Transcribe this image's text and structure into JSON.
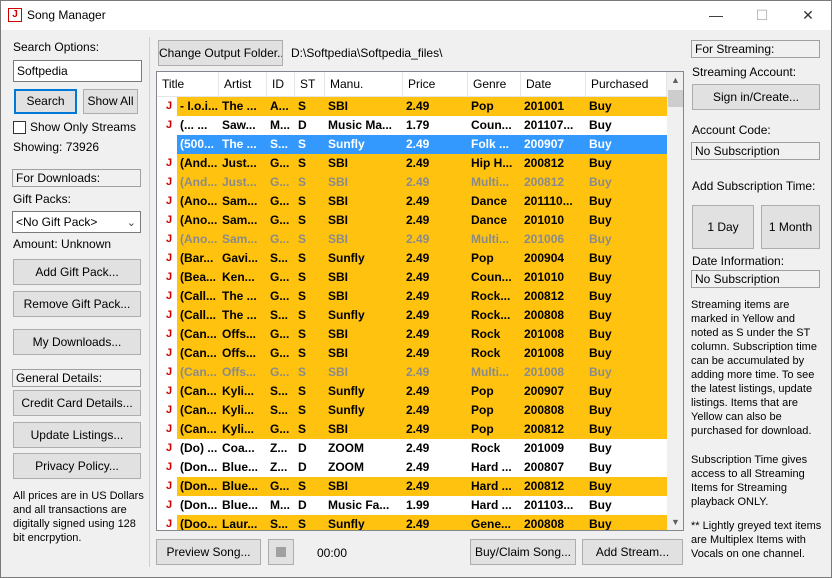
{
  "window": {
    "title": "Song Manager",
    "minimize_glyph": "—",
    "maximize_glyph": "☐",
    "close_glyph": "✕"
  },
  "left": {
    "search_options_label": "Search Options:",
    "search_value": "Softpedia",
    "search_button": "Search",
    "show_all_button": "Show All",
    "show_only_streams_label": "Show Only Streams",
    "showing_text": "Showing: 73926",
    "for_downloads_label": "For Downloads:",
    "gift_packs_label": "Gift Packs:",
    "gift_pack_selected": "<No Gift Pack>",
    "amount_text": "Amount: Unknown",
    "add_gift_pack_button": "Add Gift Pack...",
    "remove_gift_pack_button": "Remove Gift Pack...",
    "my_downloads_button": "My Downloads...",
    "general_details_label": "General Details:",
    "credit_card_button": "Credit Card Details...",
    "update_listings_button": "Update Listings...",
    "privacy_policy_button": "Privacy Policy...",
    "pricing_note": "All prices are in US Dollars and all transactions are digitally signed using 128 bit encrpytion."
  },
  "top": {
    "change_output_button": "Change Output Folder...",
    "output_path": "D:\\Softpedia\\Softpedia_files\\"
  },
  "table": {
    "columns": [
      "Title",
      "Artist",
      "ID",
      "ST",
      "Manu.",
      "Price",
      "Genre",
      "Date",
      "Purchased"
    ],
    "icon_glyph": "J",
    "rows": [
      {
        "style": "yellow",
        "cells": [
          "- I.o.i...",
          "The ...",
          "A...",
          "S",
          "SBI",
          "2.49",
          "Pop",
          "201001",
          "Buy"
        ]
      },
      {
        "style": "white",
        "cells": [
          "(... ...",
          "Saw...",
          "M...",
          "D",
          "Music Ma...",
          "1.79",
          "Coun...",
          "201107...",
          "Buy"
        ]
      },
      {
        "style": "sel",
        "cells": [
          "(500...",
          "The ...",
          "S...",
          "S",
          "Sunfly",
          "2.49",
          "Folk ...",
          "200907",
          "Buy"
        ]
      },
      {
        "style": "yellow",
        "cells": [
          "(And...",
          "Just...",
          "G...",
          "S",
          "SBI",
          "2.49",
          "Hip H...",
          "200812",
          "Buy"
        ]
      },
      {
        "style": "yellow grey",
        "cells": [
          "(And...",
          "Just...",
          "G...",
          "S",
          "SBI",
          "2.49",
          "Multi...",
          "200812",
          "Buy"
        ]
      },
      {
        "style": "yellow",
        "cells": [
          "(Ano...",
          "Sam...",
          "G...",
          "S",
          "SBI",
          "2.49",
          "Dance",
          "201110...",
          "Buy"
        ]
      },
      {
        "style": "yellow",
        "cells": [
          "(Ano...",
          "Sam...",
          "G...",
          "S",
          "SBI",
          "2.49",
          "Dance",
          "201010",
          "Buy"
        ]
      },
      {
        "style": "yellow grey",
        "cells": [
          "(Ano...",
          "Sam...",
          "G...",
          "S",
          "SBI",
          "2.49",
          "Multi...",
          "201006",
          "Buy"
        ]
      },
      {
        "style": "yellow",
        "cells": [
          "(Bar...",
          "Gavi...",
          "S...",
          "S",
          "Sunfly",
          "2.49",
          "Pop",
          "200904",
          "Buy"
        ]
      },
      {
        "style": "yellow",
        "cells": [
          "(Bea...",
          "Ken...",
          "G...",
          "S",
          "SBI",
          "2.49",
          "Coun...",
          "201010",
          "Buy"
        ]
      },
      {
        "style": "yellow",
        "cells": [
          "(Call...",
          "The ...",
          "G...",
          "S",
          "SBI",
          "2.49",
          "Rock...",
          "200812",
          "Buy"
        ]
      },
      {
        "style": "yellow",
        "cells": [
          "(Call...",
          "The ...",
          "S...",
          "S",
          "Sunfly",
          "2.49",
          "Rock...",
          "200808",
          "Buy"
        ]
      },
      {
        "style": "yellow",
        "cells": [
          "(Can...",
          "Offs...",
          "G...",
          "S",
          "SBI",
          "2.49",
          "Rock",
          "201008",
          "Buy"
        ]
      },
      {
        "style": "yellow",
        "cells": [
          "(Can...",
          "Offs...",
          "G...",
          "S",
          "SBI",
          "2.49",
          "Rock",
          "201008",
          "Buy"
        ]
      },
      {
        "style": "yellow grey",
        "cells": [
          "(Can...",
          "Offs...",
          "G...",
          "S",
          "SBI",
          "2.49",
          "Multi...",
          "201008",
          "Buy"
        ]
      },
      {
        "style": "yellow",
        "cells": [
          "(Can...",
          "Kyli...",
          "S...",
          "S",
          "Sunfly",
          "2.49",
          "Pop",
          "200907",
          "Buy"
        ]
      },
      {
        "style": "yellow",
        "cells": [
          "(Can...",
          "Kyli...",
          "S...",
          "S",
          "Sunfly",
          "2.49",
          "Pop",
          "200808",
          "Buy"
        ]
      },
      {
        "style": "yellow",
        "cells": [
          "(Can...",
          "Kyli...",
          "G...",
          "S",
          "SBI",
          "2.49",
          "Pop",
          "200812",
          "Buy"
        ]
      },
      {
        "style": "white",
        "cells": [
          "(Do) ...",
          "Coa...",
          "Z...",
          "D",
          "ZOOM",
          "2.49",
          "Rock",
          "201009",
          "Buy"
        ]
      },
      {
        "style": "white",
        "cells": [
          "(Don...",
          "Blue...",
          "Z...",
          "D",
          "ZOOM",
          "2.49",
          "Hard ...",
          "200807",
          "Buy"
        ]
      },
      {
        "style": "yellow",
        "cells": [
          "(Don...",
          "Blue...",
          "G...",
          "S",
          "SBI",
          "2.49",
          "Hard ...",
          "200812",
          "Buy"
        ]
      },
      {
        "style": "white",
        "cells": [
          "(Don...",
          "Blue...",
          "M...",
          "D",
          "Music Fa...",
          "1.99",
          "Hard ...",
          "201103...",
          "Buy"
        ]
      },
      {
        "style": "yellow",
        "cells": [
          "(Doo...",
          "Laur...",
          "S...",
          "S",
          "Sunfly",
          "2.49",
          "Gene...",
          "200808",
          "Buy"
        ]
      }
    ]
  },
  "bottom": {
    "preview_button": "Preview Song...",
    "time_text": "00:00",
    "buy_claim_button": "Buy/Claim Song...",
    "add_stream_button": "Add Stream..."
  },
  "right": {
    "for_streaming_label": "For Streaming:",
    "streaming_account_label": "Streaming Account:",
    "signin_button": "Sign in/Create...",
    "account_code_label": "Account Code:",
    "account_code_value": "No Subscription",
    "add_sub_time_label": "Add Subscription Time:",
    "one_day_button": "1 Day",
    "one_month_button": "1 Month",
    "date_info_label": "Date Information:",
    "date_info_value": "No Subscription",
    "streaming_note": "Streaming items are marked in Yellow and noted as S under the ST column. Subscription time can be accumulated by adding more time. To see the latest listings, update listings. Items that are Yellow can also be purchased for download.",
    "subscription_note": "Subscription Time gives access to all Streaming Items for Streaming playback ONLY.",
    "greyed_note": "** Lightly greyed text items are Multiplex Items with Vocals on one channel."
  },
  "colors": {
    "stream_row": "#ffc30f",
    "selected_row": "#3399ff",
    "focus_border": "#0078d7"
  }
}
